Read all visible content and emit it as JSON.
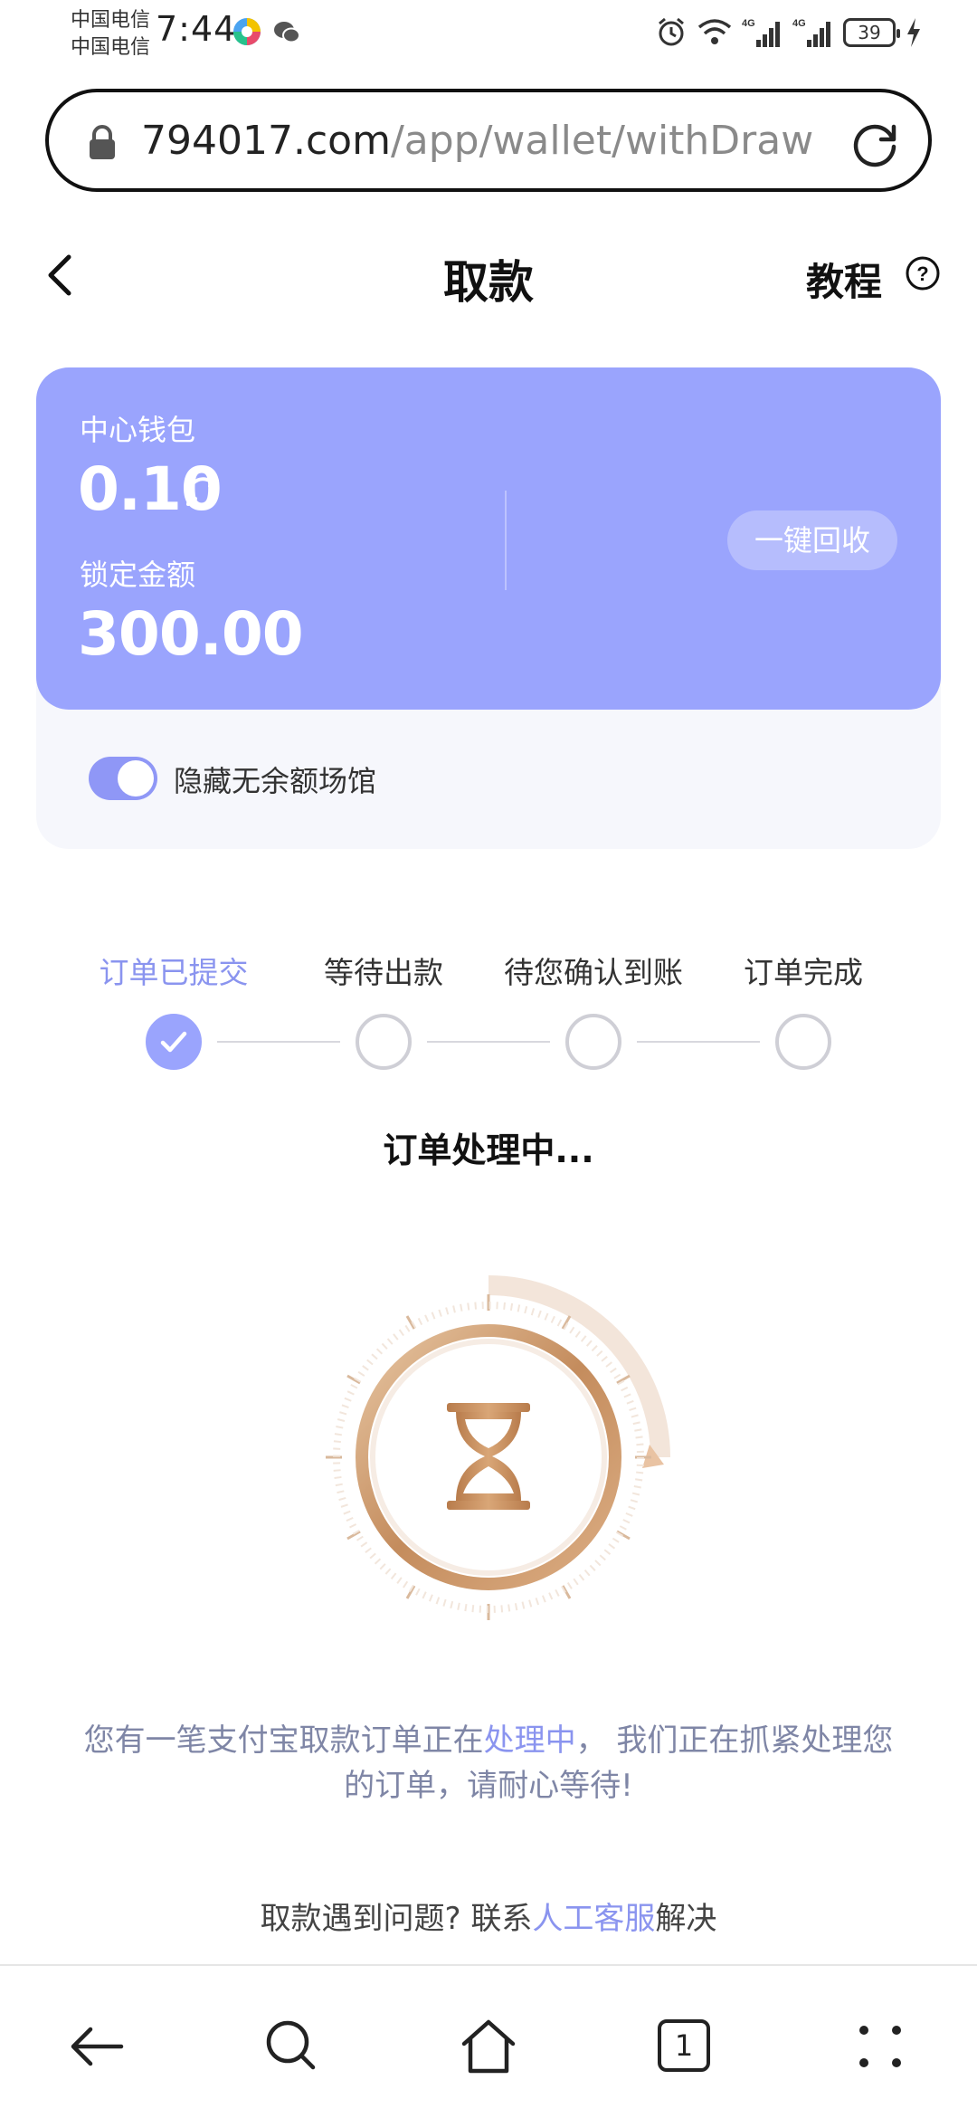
{
  "status_bar": {
    "carrier1": "中国电信",
    "carrier2": "中国电信",
    "time": "7:44",
    "battery": "39",
    "icons": [
      "alarm-icon",
      "wifi-icon",
      "signal-4g-icon",
      "signal-4g-icon",
      "battery-icon",
      "charging-icon"
    ]
  },
  "url_bar": {
    "domain": "794017.com",
    "path": "/app/wallet/withDraw"
  },
  "header": {
    "title": "取款",
    "tutorial_label": "教程"
  },
  "wallet": {
    "center_wallet_label": "中心钱包",
    "balance": "0.10",
    "locked_label": "锁定金额",
    "locked_amount": "300.00",
    "recycle_button": "一键回收",
    "hide_toggle_label": "隐藏无余额场馆",
    "hide_toggle_on": true
  },
  "steps": {
    "items": [
      {
        "label": "订单已提交",
        "done": true
      },
      {
        "label": "等待出款",
        "done": false
      },
      {
        "label": "待您确认到账",
        "done": false
      },
      {
        "label": "订单完成",
        "done": false
      }
    ],
    "status_title": "订单处理中..."
  },
  "notice": {
    "part1": "您有一笔支付宝取款订单正在",
    "highlight": "处理中",
    "part2": "， 我们正在抓紧处理您的订单，请耐心等待!"
  },
  "help": {
    "prefix": "取款遇到问题? 联系",
    "link": "人工客服",
    "suffix": "解决"
  },
  "bottom_nav": {
    "tab_count": "1",
    "items": [
      "back-icon",
      "search-icon",
      "home-icon",
      "tabs-icon",
      "more-icon"
    ]
  },
  "colors": {
    "accent": "#9aa4fd",
    "accent_text": "#8a94ef",
    "hourglass": "#c28b5c"
  }
}
